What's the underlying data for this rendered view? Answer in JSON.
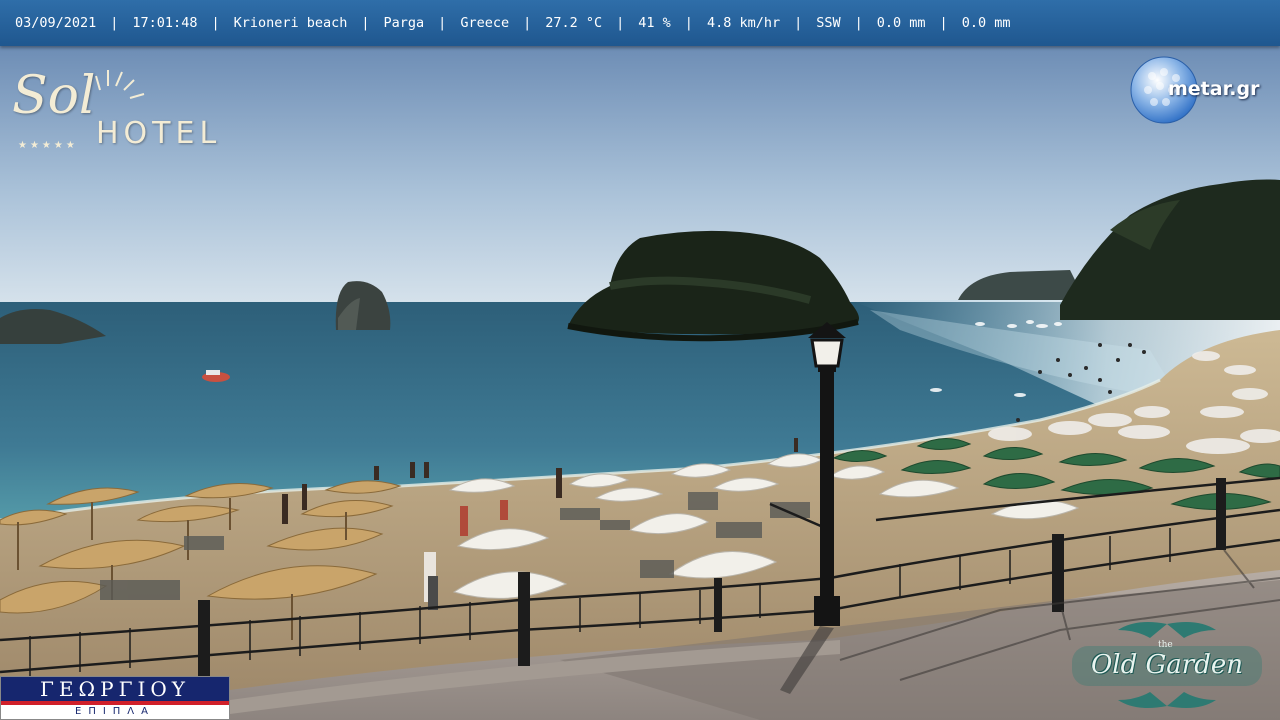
{
  "status_bar": {
    "date": "03/09/2021",
    "time": "17:01:48",
    "location": "Krioneri beach",
    "city": "Parga",
    "country": "Greece",
    "temperature": "27.2 °C",
    "humidity": "41 %",
    "wind_speed": "4.8 km/hr",
    "wind_direction": "SSW",
    "rain": "0.0 mm",
    "rain_rate": "0.0 mm",
    "separator": "|"
  },
  "logos": {
    "sol": {
      "script": "Sol",
      "word": "HOTEL",
      "stars": "★★★★★"
    },
    "metar": {
      "text": "metar.gr",
      "icon": "golf-ball-globe-icon"
    },
    "georgiou": {
      "top": "ΓΕΩΡΓΙΟΥ",
      "bottom": "ΕΠΙΠΛΑ"
    },
    "old_garden": {
      "small": "the",
      "text": "Old Garden"
    }
  },
  "colors": {
    "bar": "#2563a0",
    "sky_top": "#6f8fb6",
    "sky_horizon": "#c9d9e6",
    "sea": "#3f7a94",
    "sand": "#c8b08a",
    "foliage": "#1f2a1c"
  }
}
